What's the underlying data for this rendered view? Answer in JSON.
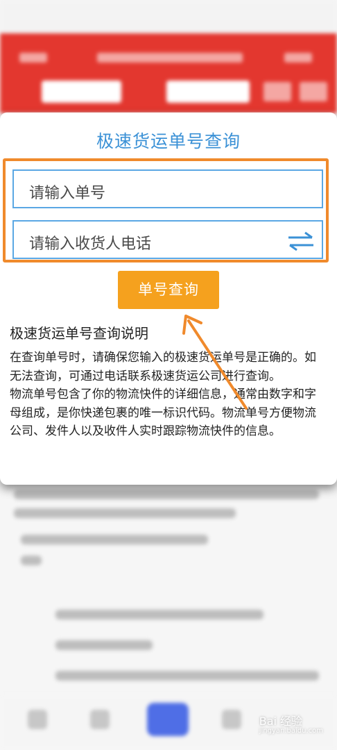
{
  "modal": {
    "title": "极速货运单号查询",
    "order_placeholder": "请输入单号",
    "phone_placeholder": "请输入收货人电话",
    "query_button": "单号查询",
    "desc_title": "极速货运单号查询说明",
    "desc_para1": "在查询单号时，请确保您输入的极速货运单号是正确的。如无法查询，可通过电话联系极速货运公司进行查询。",
    "desc_para2": "物流单号包含了你的物流快件的详细信息，通常由数字和字母组成，是你快递包裹的唯一标识代码。物流单号方便物流公司、发件人以及收件人实时跟踪物流快件的信息。"
  },
  "annotation": {
    "highlight_color": "#f08a2c",
    "arrow_color": "#f08a2c"
  },
  "icons": {
    "swap": "swap-arrows-icon"
  },
  "watermark": {
    "brand": "Bai 经验",
    "sub": "jingyan.baidu.com"
  }
}
